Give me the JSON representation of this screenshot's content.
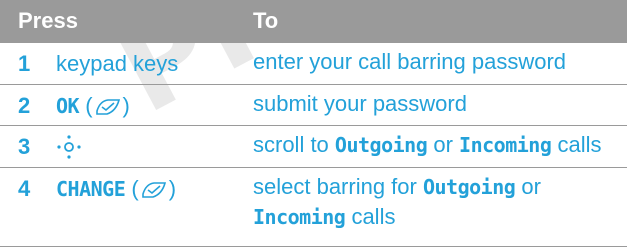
{
  "watermark": "PRE",
  "table": {
    "header": {
      "press": "Press",
      "to": "To"
    },
    "rows": [
      {
        "num": "1",
        "press": "keypad keys",
        "to_text": "enter your call barring password"
      },
      {
        "num": "2",
        "press_key": "OK",
        "press_open": " (",
        "press_close": ")",
        "press_icon": "right-softkey-icon",
        "to_text": "submit your password"
      },
      {
        "num": "3",
        "press_icon": "navigation-key-icon",
        "to_a": "scroll to ",
        "to_k1": "Outgoing",
        "to_b": " or ",
        "to_k2": "Incoming",
        "to_c": " calls"
      },
      {
        "num": "4",
        "press_key": "CHANGE",
        "press_open": " (",
        "press_close": ")",
        "press_icon": "right-softkey-icon",
        "to_a": "select barring for ",
        "to_k1": "Outgoing",
        "to_b": " or ",
        "to_k2": "Incoming",
        "to_c": " calls"
      }
    ]
  },
  "colors": {
    "header_bg": "#9a9a9a",
    "header_text": "#ffffff",
    "body_text": "#23a1d9",
    "divider": "#9a9a9a",
    "watermark": "#e9e9e9"
  }
}
